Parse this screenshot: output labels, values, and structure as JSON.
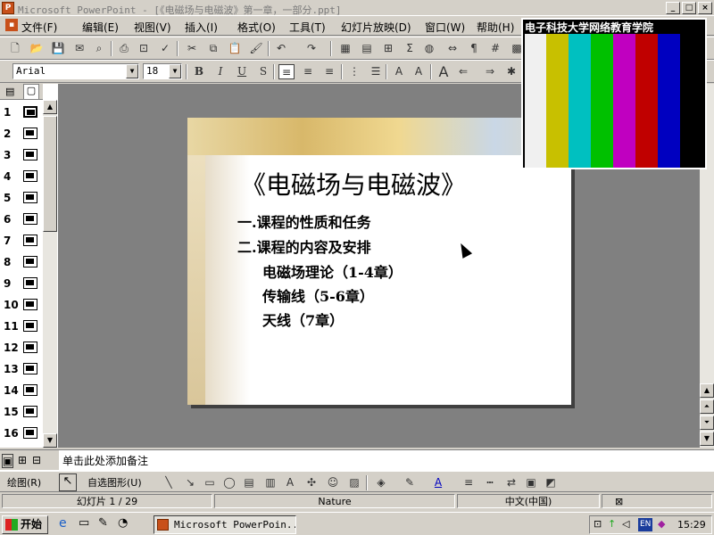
{
  "window": {
    "title": "Microsoft PowerPoint - [《电磁场与电磁波》第一章，一部分.ppt]",
    "icon": "powerpoint-icon"
  },
  "menu": [
    "文件(F)",
    "编辑(E)",
    "视图(V)",
    "插入(I)",
    "格式(O)",
    "工具(T)",
    "幻灯片放映(D)",
    "窗口(W)",
    "帮助(H)"
  ],
  "format_toolbar": {
    "font": "Arial",
    "size": "18",
    "bold": "B",
    "italic": "I",
    "underline": "U",
    "shadow": "S"
  },
  "slides": [
    {
      "n": "1"
    },
    {
      "n": "2"
    },
    {
      "n": "3"
    },
    {
      "n": "4"
    },
    {
      "n": "5"
    },
    {
      "n": "6"
    },
    {
      "n": "7"
    },
    {
      "n": "8"
    },
    {
      "n": "9"
    },
    {
      "n": "10"
    },
    {
      "n": "11"
    },
    {
      "n": "12"
    },
    {
      "n": "13"
    },
    {
      "n": "14"
    },
    {
      "n": "15"
    },
    {
      "n": "16"
    }
  ],
  "slide": {
    "title": "《电磁场与电磁波》",
    "bullets": [
      "一.课程的性质和任务",
      "二.课程的内容及安排",
      "电磁场理论（1-4章）",
      "传输线（5-6章）",
      "天线（7章）"
    ]
  },
  "notes_placeholder": "单击此处添加备注",
  "drawing": {
    "draw_label": "绘图(R)",
    "autoshapes_label": "自选图形(U)"
  },
  "status": {
    "slide": "幻灯片 1 / 29",
    "design": "Nature",
    "language": "中文(中国)"
  },
  "taskbar": {
    "start": "开始",
    "task": "Microsoft PowerPoin...",
    "clock": "15:29",
    "lang": "EN"
  },
  "overlay": {
    "title": "电子科技大学网络教育学院",
    "bars": [
      "#f0f0f0",
      "#c8c000",
      "#00c0c0",
      "#00c000",
      "#c000c0",
      "#c00000",
      "#0000c0",
      "#000000"
    ]
  }
}
